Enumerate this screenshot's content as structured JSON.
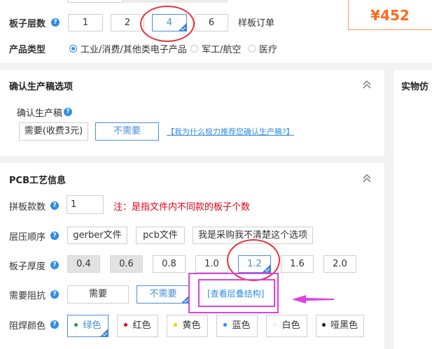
{
  "board_layers": {
    "label": "板子层数",
    "options": [
      "1",
      "2",
      "4",
      "6"
    ],
    "selected": "4",
    "extra_label": "样板订单"
  },
  "product_type": {
    "label": "产品类型",
    "options": [
      "工业/消费/其他类电子产品",
      "军工/航空",
      "医疗"
    ],
    "selected": "工业/消费/其他类电子产品"
  },
  "price": {
    "value": "¥452",
    "color": "#ff6b1a"
  },
  "confirm_section": {
    "title": "确认生产稿选项",
    "field_label": "确认生产稿",
    "options": [
      "需要(收费3元)",
      "不需要"
    ],
    "selected": "不需要",
    "link": "【我为什么极力推荐您确认生产稿?】"
  },
  "side_section": {
    "title": "实物仿"
  },
  "pcb_section": {
    "title": "PCB工艺信息",
    "panel_count": {
      "label": "拼板款数",
      "value": "1",
      "note": "注：是指文件内不同款的板子个数"
    },
    "stack_order": {
      "label": "层压顺序",
      "options": [
        "gerber文件",
        "pcb文件",
        "我是采购我不清楚这个选项"
      ]
    },
    "thickness": {
      "label": "板子厚度",
      "options": [
        "0.4",
        "0.6",
        "0.8",
        "1.0",
        "1.2",
        "1.6",
        "2.0"
      ],
      "selected": "1.2"
    },
    "impedance": {
      "label": "需要阻抗",
      "options": [
        "需要",
        "不需要"
      ],
      "selected": "不需要",
      "link": "[查看层叠结构]"
    },
    "solder_color": {
      "label": "阻焊颜色",
      "options": [
        {
          "name": "绿色",
          "color": "#1a9e3a"
        },
        {
          "name": "红色",
          "color": "#e60012"
        },
        {
          "name": "黄色",
          "color": "#f5c400"
        },
        {
          "name": "蓝色",
          "color": "#1e90ff"
        },
        {
          "name": "白色",
          "color": "#eeeeee"
        },
        {
          "name": "哑黑色",
          "color": "#111111"
        }
      ],
      "selected": "绿色"
    }
  },
  "annotation_colors": {
    "circle": "#e8333a",
    "highlight": "#e040e0",
    "accent": "#3d85d6"
  }
}
